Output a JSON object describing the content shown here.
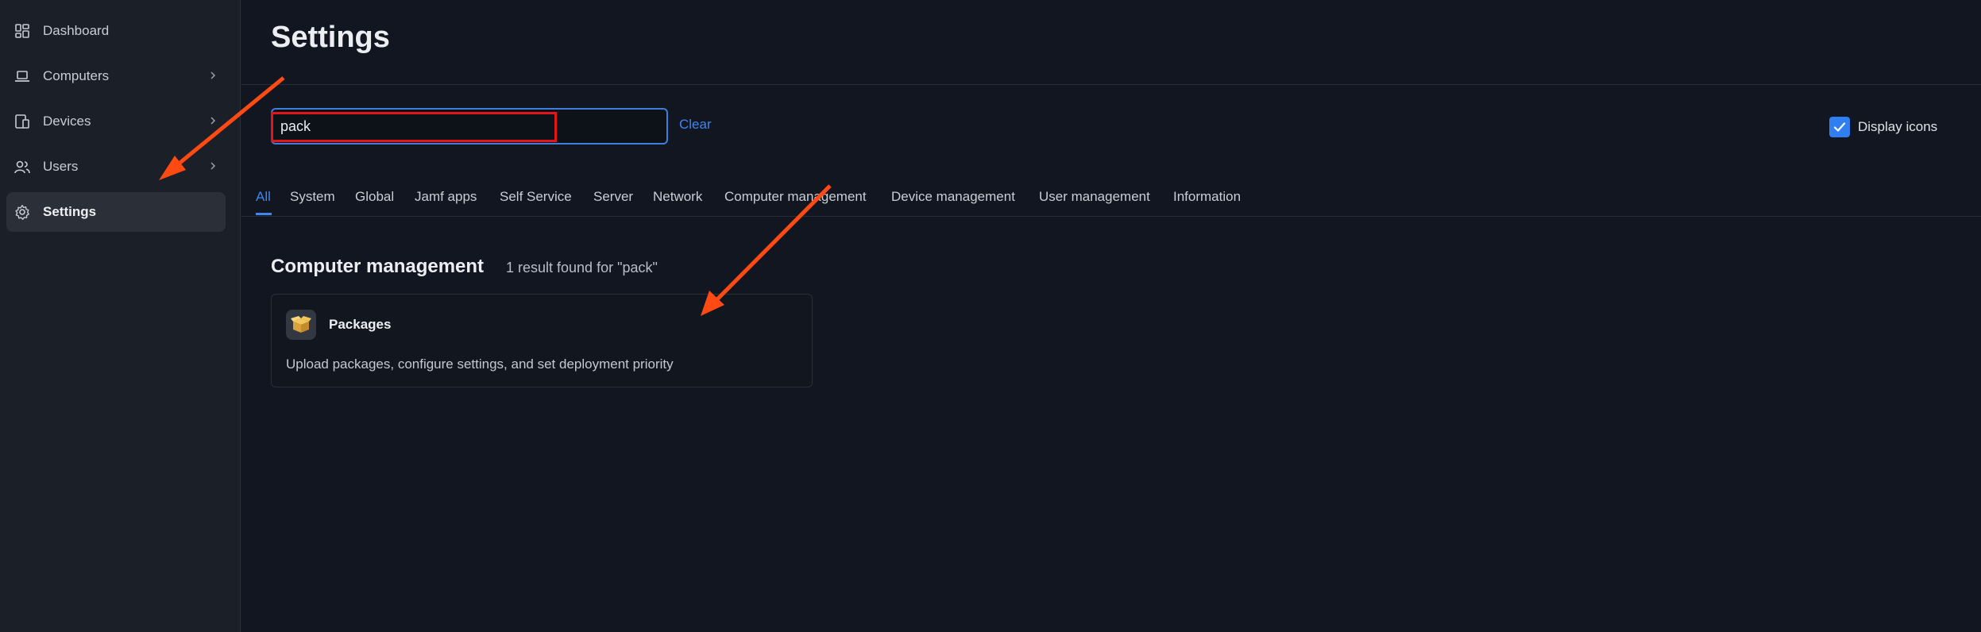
{
  "sidebar": {
    "items": [
      {
        "label": "Dashboard",
        "icon": "dashboard-icon",
        "has_chevron": false,
        "active": false
      },
      {
        "label": "Computers",
        "icon": "laptop-icon",
        "has_chevron": true,
        "active": false
      },
      {
        "label": "Devices",
        "icon": "devices-icon",
        "has_chevron": true,
        "active": false
      },
      {
        "label": "Users",
        "icon": "users-icon",
        "has_chevron": true,
        "active": false
      },
      {
        "label": "Settings",
        "icon": "gear-icon",
        "has_chevron": false,
        "active": true
      }
    ]
  },
  "header": {
    "title": "Settings"
  },
  "search": {
    "value": "pack",
    "clear_label": "Clear"
  },
  "display_icons": {
    "label": "Display icons",
    "checked": true
  },
  "tabs": [
    {
      "label": "All",
      "active": true
    },
    {
      "label": "System",
      "active": false
    },
    {
      "label": "Global",
      "active": false
    },
    {
      "label": "Jamf apps",
      "active": false
    },
    {
      "label": "Self Service",
      "active": false
    },
    {
      "label": "Server",
      "active": false
    },
    {
      "label": "Network",
      "active": false
    },
    {
      "label": "Computer management",
      "active": false
    },
    {
      "label": "Device management",
      "active": false
    },
    {
      "label": "User management",
      "active": false
    },
    {
      "label": "Information",
      "active": false
    }
  ],
  "results": {
    "section_title": "Computer management",
    "count_text": "1 result found for \"pack\"",
    "items": [
      {
        "title": "Packages",
        "description": "Upload packages, configure settings, and set deployment priority",
        "icon": "package-box-icon"
      }
    ]
  },
  "colors": {
    "accent": "#3d86f0",
    "highlight_box": "#e3141c",
    "annotation_arrow": "#ff4a14",
    "background": "#111620",
    "sidebar_bg": "#1b1f27"
  }
}
